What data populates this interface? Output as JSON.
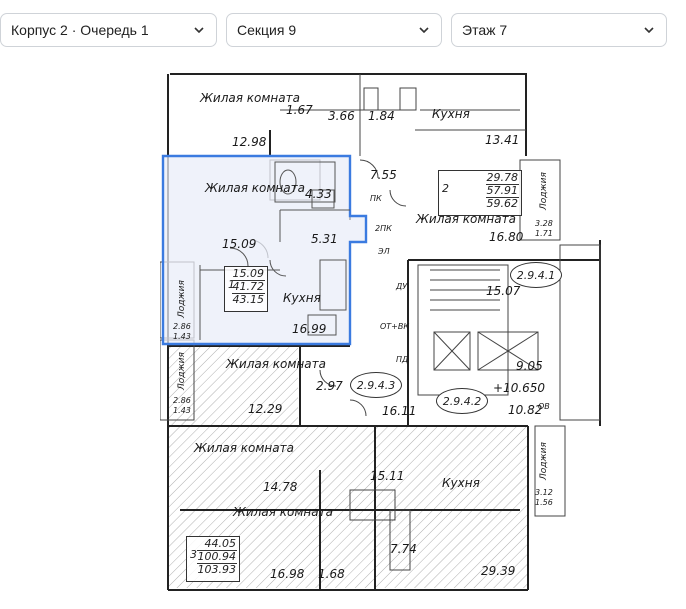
{
  "filters": {
    "building": "Корпус 2 · Очередь 1",
    "section": "Секция 9",
    "floor": "Этаж 7"
  },
  "colors": {
    "accent": "#3b7be0",
    "selected_fill": "#e9eef8",
    "hatch": "#8c8c8c"
  },
  "icons": {
    "chevron": "chevron-down-icon"
  },
  "plan": {
    "rooms": {
      "top_left_living": "Жилая комната",
      "top_left_living_area": "12.98",
      "top_small_1": "1.67",
      "top_small_2": "3.66",
      "top_small_3": "1.84",
      "top_right_kitchen": "Кухня",
      "top_right_kitchen_area": "13.41",
      "corridor_top": "7.55",
      "apt2_living": "Жилая комната",
      "apt2_living_area": "16.80",
      "sel_living": "Жилая комната",
      "sel_living_area": "15.09",
      "sel_bath": "4.33",
      "sel_hall": "5.31",
      "sel_kitchen": "Кухня",
      "sel_kitchen_area": "16.99",
      "loggia_label": "Лоджия",
      "loggia_left_1_a": "2.86",
      "loggia_left_1_b": "1.43",
      "loggia_left_2_a": "2.86",
      "loggia_left_2_b": "1.43",
      "loggia_right_top_a": "3.28",
      "loggia_right_top_b": "1.71",
      "loggia_right_bot_a": "3.12",
      "loggia_right_bot_b": "1.56",
      "mid_left_living": "Жилая комната",
      "mid_left_living_area": "12.29",
      "mid_small": "2.97",
      "lower_left_living": "Жилая комната",
      "lower_left_living_area": "14.78",
      "bottom_living": "Жилая комната",
      "bottom_living_area": "16.98",
      "bottom_small_1": "1.68",
      "bottom_small_2": "7.74",
      "bottom_hall": "15.11",
      "bottom_kitchen": "Кухня",
      "bottom_kitchen_area": "29.39",
      "stair_area": "15.07",
      "lift_hall": "16.11",
      "elev_right": "9.05",
      "elev_level": "+10.650",
      "elev_area": "10.82",
      "elev_ov": "ОВ",
      "ot_vk": "ОТ+ВК",
      "pk": "ПК",
      "pk2": "2ПК",
      "el": "ЭЛ",
      "pd": "ПД",
      "du": "ДУ"
    },
    "apartments": [
      {
        "num": "2",
        "v1": "29.78",
        "v2": "57.91",
        "v3": "59.62"
      },
      {
        "num": "1",
        "v1": "15.09",
        "v2": "41.72",
        "v3": "43.15"
      },
      {
        "num": "3",
        "v1": "44.05",
        "v2": "100.94",
        "v3": "103.93"
      }
    ],
    "tags": [
      "2.9.4.1",
      "2.9.4.3",
      "2.9.4.2"
    ]
  }
}
